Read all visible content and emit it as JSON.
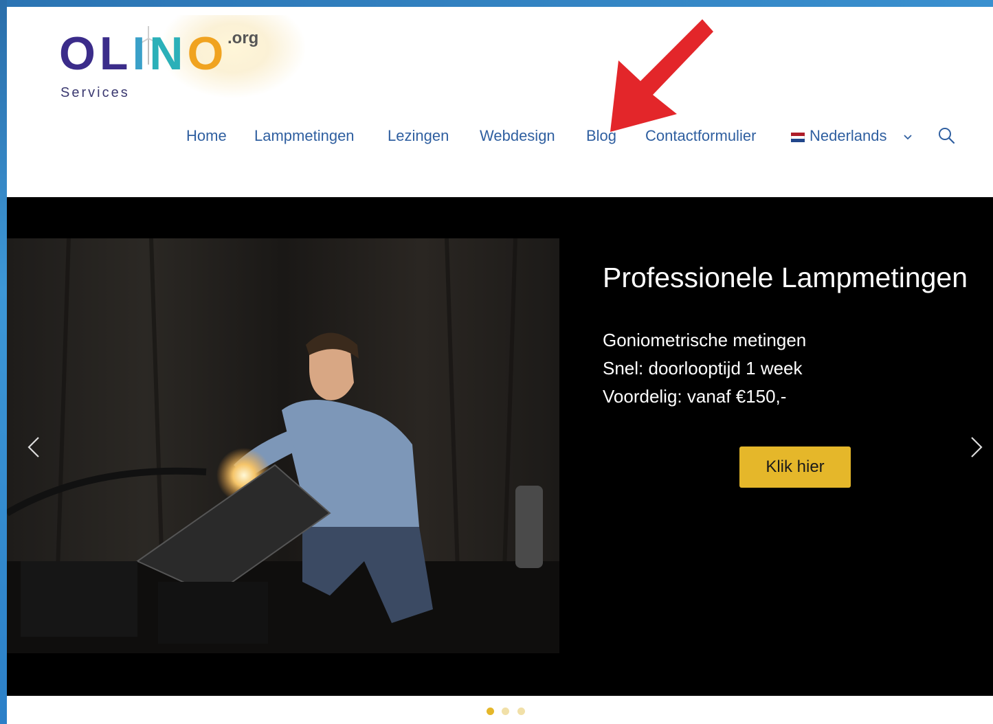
{
  "logo": {
    "word_o1": "O",
    "word_l": "L",
    "word_i": "I",
    "word_n": "N",
    "word_o2": "O",
    "org": ".org",
    "services": "Services"
  },
  "nav": {
    "items": [
      {
        "label": "Home"
      },
      {
        "label": "Lampmetingen"
      },
      {
        "label": "Lezingen"
      },
      {
        "label": "Webdesign"
      },
      {
        "label": "Blog"
      },
      {
        "label": "Contactformulier"
      },
      {
        "label": "Nederlands"
      }
    ],
    "language_flag": "netherlands-flag-icon",
    "language_menu_icon": "chevron-down-icon",
    "search_icon": "search-icon"
  },
  "slide": {
    "title": "Professionele Lampmetingen",
    "lines": [
      "Goniometrische metingen",
      "Snel: doorlooptijd 1 week",
      "Voordelig: vanaf €150,-"
    ],
    "cta_label": "Klik hier",
    "prev_icon": "chevron-left-icon",
    "next_icon": "chevron-right-icon",
    "active_dot": 1,
    "dot_count": 3
  },
  "colors": {
    "nav_link": "#2f5fa0",
    "cta": "#e5b72a",
    "dot_active": "#e5b72a",
    "dot_inactive": "#f1e0a8",
    "annotation_arrow": "#e3262a",
    "frame_blue": "#2d7fc1"
  }
}
